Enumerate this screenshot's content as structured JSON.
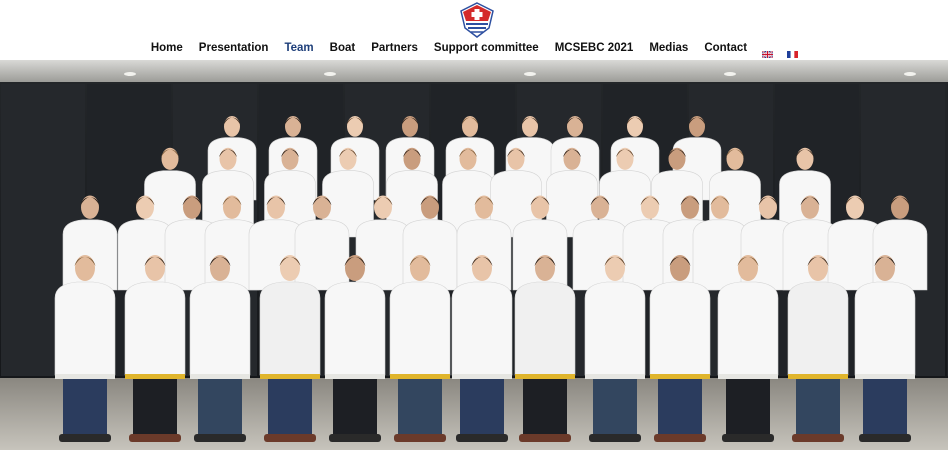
{
  "header": {
    "logo_name": "club-logo",
    "nav": [
      {
        "label": "Home",
        "active": false
      },
      {
        "label": "Presentation",
        "active": false
      },
      {
        "label": "Team",
        "active": true
      },
      {
        "label": "Boat",
        "active": false
      },
      {
        "label": "Partners",
        "active": false
      },
      {
        "label": "Support committee",
        "active": false
      },
      {
        "label": "MCSEBC 2021",
        "active": false
      },
      {
        "label": "Medias",
        "active": false
      },
      {
        "label": "Contact",
        "active": false
      }
    ],
    "languages": [
      {
        "icon": "uk-flag-icon"
      },
      {
        "icon": "france-flag-icon"
      }
    ]
  },
  "colors": {
    "accent": "#1e3f7a",
    "logo_red": "#d42a2a",
    "logo_blue": "#2d4fa0"
  },
  "photo": {
    "subject": "team-group-photo"
  }
}
